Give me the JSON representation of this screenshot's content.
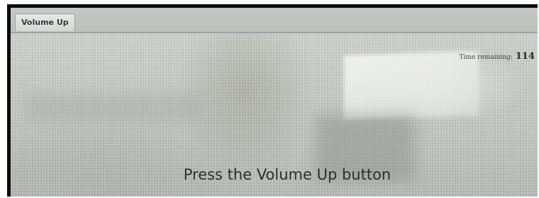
{
  "tabs": [
    {
      "label": "Volume Up"
    }
  ],
  "timer": {
    "label": "Time remaining:",
    "value": "114"
  },
  "prompt": {
    "text": "Press the Volume Up button"
  },
  "colors": {
    "screen_background": "#c9ccc7",
    "tab_background": "#e6e8e4",
    "text": "#2d2f2e",
    "frame": "#0c0c0c"
  }
}
